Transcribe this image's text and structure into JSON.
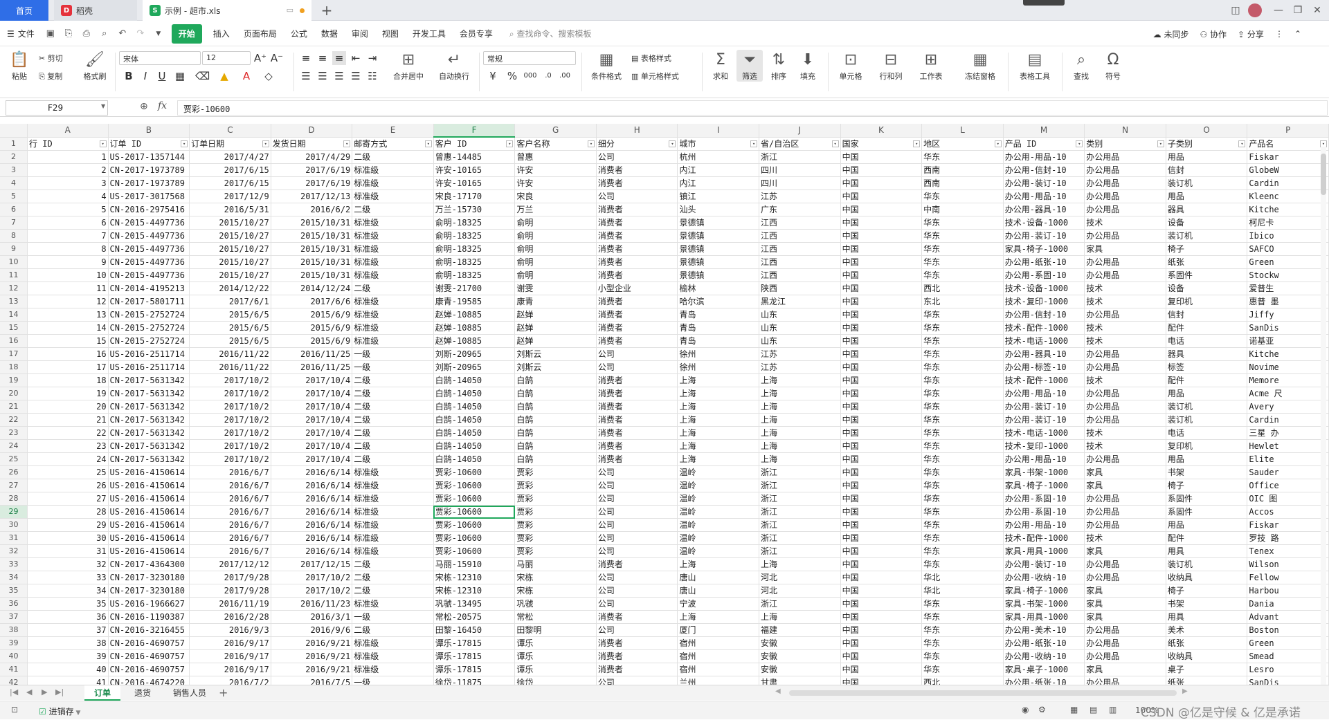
{
  "window": {
    "tabs": [
      {
        "label": "首页"
      },
      {
        "label": "稻壳"
      },
      {
        "label": "示例 - 超市.xls"
      }
    ]
  },
  "menu": {
    "file_label": "文件",
    "items": [
      "开始",
      "插入",
      "页面布局",
      "公式",
      "数据",
      "审阅",
      "视图",
      "开发工具",
      "会员专享"
    ],
    "search_placeholder": "查找命令、搜索模板",
    "sync_label": "未同步",
    "collab_label": "协作",
    "share_label": "分享"
  },
  "ribbon": {
    "paste": "粘贴",
    "cut": "剪切",
    "copy": "复制",
    "format_painter": "格式刷",
    "font_name": "宋体",
    "font_size": "12",
    "merge": "合并居中",
    "wrap": "自动换行",
    "number_format": "常规",
    "cond_format": "条件格式",
    "table_style": "表格样式",
    "cell_style": "单元格样式",
    "sum": "求和",
    "filter": "筛选",
    "sort": "排序",
    "fill": "填充",
    "cell": "单元格",
    "row_col": "行和列",
    "worksheet": "工作表",
    "freeze": "冻结窗格",
    "table_tools": "表格工具",
    "find": "查找",
    "symbol": "符号"
  },
  "formula_bar": {
    "name_box": "F29",
    "fx": "fx",
    "content": "贾彩-10600"
  },
  "grid": {
    "columns": [
      "A",
      "B",
      "C",
      "D",
      "E",
      "F",
      "G",
      "H",
      "I",
      "J",
      "K",
      "L",
      "M",
      "N",
      "O",
      "P"
    ],
    "selected_column": "F",
    "selected_row": 29,
    "headers": [
      "行 ID",
      "订单 ID",
      "订单日期",
      "发货日期",
      "邮寄方式",
      "客户 ID",
      "客户名称",
      "细分",
      "城市",
      "省/自治区",
      "国家",
      "地区",
      "产品 ID",
      "类别",
      "子类别",
      "产品名"
    ],
    "rows": [
      [
        "1",
        "US-2017-1357144",
        "2017/4/27",
        "2017/4/29",
        "二级",
        "曾惠-14485",
        "曾惠",
        "公司",
        "杭州",
        "浙江",
        "中国",
        "华东",
        "办公用-用品-10",
        "办公用品",
        "用品",
        "Fiskar"
      ],
      [
        "2",
        "CN-2017-1973789",
        "2017/6/15",
        "2017/6/19",
        "标准级",
        "许安-10165",
        "许安",
        "消费者",
        "内江",
        "四川",
        "中国",
        "西南",
        "办公用-信封-10",
        "办公用品",
        "信封",
        "GlobeW"
      ],
      [
        "3",
        "CN-2017-1973789",
        "2017/6/15",
        "2017/6/19",
        "标准级",
        "许安-10165",
        "许安",
        "消费者",
        "内江",
        "四川",
        "中国",
        "西南",
        "办公用-装订-10",
        "办公用品",
        "装订机",
        "Cardin"
      ],
      [
        "4",
        "US-2017-3017568",
        "2017/12/9",
        "2017/12/13",
        "标准级",
        "宋良-17170",
        "宋良",
        "公司",
        "镇江",
        "江苏",
        "中国",
        "华东",
        "办公用-用品-10",
        "办公用品",
        "用品",
        "Kleenc"
      ],
      [
        "5",
        "CN-2016-2975416",
        "2016/5/31",
        "2016/6/2",
        "二级",
        "万兰-15730",
        "万兰",
        "消费者",
        "汕头",
        "广东",
        "中国",
        "中南",
        "办公用-器具-10",
        "办公用品",
        "器具",
        "Kitche"
      ],
      [
        "6",
        "CN-2015-4497736",
        "2015/10/27",
        "2015/10/31",
        "标准级",
        "俞明-18325",
        "俞明",
        "消费者",
        "景德镇",
        "江西",
        "中国",
        "华东",
        "技术-设备-1000",
        "技术",
        "设备",
        "柯尼卡"
      ],
      [
        "7",
        "CN-2015-4497736",
        "2015/10/27",
        "2015/10/31",
        "标准级",
        "俞明-18325",
        "俞明",
        "消费者",
        "景德镇",
        "江西",
        "中国",
        "华东",
        "办公用-装订-10",
        "办公用品",
        "装订机",
        "Ibico "
      ],
      [
        "8",
        "CN-2015-4497736",
        "2015/10/27",
        "2015/10/31",
        "标准级",
        "俞明-18325",
        "俞明",
        "消费者",
        "景德镇",
        "江西",
        "中国",
        "华东",
        "家具-椅子-1000",
        "家具",
        "椅子",
        "SAFCO "
      ],
      [
        "9",
        "CN-2015-4497736",
        "2015/10/27",
        "2015/10/31",
        "标准级",
        "俞明-18325",
        "俞明",
        "消费者",
        "景德镇",
        "江西",
        "中国",
        "华东",
        "办公用-纸张-10",
        "办公用品",
        "纸张",
        "Green "
      ],
      [
        "10",
        "CN-2015-4497736",
        "2015/10/27",
        "2015/10/31",
        "标准级",
        "俞明-18325",
        "俞明",
        "消费者",
        "景德镇",
        "江西",
        "中国",
        "华东",
        "办公用-系固-10",
        "办公用品",
        "系固件",
        "Stockw"
      ],
      [
        "11",
        "CN-2014-4195213",
        "2014/12/22",
        "2014/12/24",
        "二级",
        "谢雯-21700",
        "谢雯",
        "小型企业",
        "榆林",
        "陕西",
        "中国",
        "西北",
        "技术-设备-1000",
        "技术",
        "设备",
        "爱普生"
      ],
      [
        "12",
        "CN-2017-5801711",
        "2017/6/1",
        "2017/6/6",
        "标准级",
        "康青-19585",
        "康青",
        "消费者",
        "哈尔滨",
        "黑龙江",
        "中国",
        "东北",
        "技术-复印-1000",
        "技术",
        "复印机",
        "惠普 墨"
      ],
      [
        "13",
        "CN-2015-2752724",
        "2015/6/5",
        "2015/6/9",
        "标准级",
        "赵婵-10885",
        "赵婵",
        "消费者",
        "青岛",
        "山东",
        "中国",
        "华东",
        "办公用-信封-10",
        "办公用品",
        "信封",
        "Jiffy "
      ],
      [
        "14",
        "CN-2015-2752724",
        "2015/6/5",
        "2015/6/9",
        "标准级",
        "赵婵-10885",
        "赵婵",
        "消费者",
        "青岛",
        "山东",
        "中国",
        "华东",
        "技术-配件-1000",
        "技术",
        "配件",
        "SanDis"
      ],
      [
        "15",
        "CN-2015-2752724",
        "2015/6/5",
        "2015/6/9",
        "标准级",
        "赵婵-10885",
        "赵婵",
        "消费者",
        "青岛",
        "山东",
        "中国",
        "华东",
        "技术-电话-1000",
        "技术",
        "电话",
        "诺基亚"
      ],
      [
        "16",
        "US-2016-2511714",
        "2016/11/22",
        "2016/11/25",
        "一级",
        "刘斯-20965",
        "刘斯云",
        "公司",
        "徐州",
        "江苏",
        "中国",
        "华东",
        "办公用-器具-10",
        "办公用品",
        "器具",
        "Kitche"
      ],
      [
        "17",
        "US-2016-2511714",
        "2016/11/22",
        "2016/11/25",
        "一级",
        "刘斯-20965",
        "刘斯云",
        "公司",
        "徐州",
        "江苏",
        "中国",
        "华东",
        "办公用-标签-10",
        "办公用品",
        "标签",
        "Novime"
      ],
      [
        "18",
        "CN-2017-5631342",
        "2017/10/2",
        "2017/10/4",
        "二级",
        "白鹄-14050",
        "白鹄",
        "消费者",
        "上海",
        "上海",
        "中国",
        "华东",
        "技术-配件-1000",
        "技术",
        "配件",
        "Memore"
      ],
      [
        "19",
        "CN-2017-5631342",
        "2017/10/2",
        "2017/10/4",
        "二级",
        "白鹄-14050",
        "白鹄",
        "消费者",
        "上海",
        "上海",
        "中国",
        "华东",
        "办公用-用品-10",
        "办公用品",
        "用品",
        "Acme 尺"
      ],
      [
        "20",
        "CN-2017-5631342",
        "2017/10/2",
        "2017/10/4",
        "二级",
        "白鹄-14050",
        "白鹄",
        "消费者",
        "上海",
        "上海",
        "中国",
        "华东",
        "办公用-装订-10",
        "办公用品",
        "装订机",
        "Avery "
      ],
      [
        "21",
        "CN-2017-5631342",
        "2017/10/2",
        "2017/10/4",
        "二级",
        "白鹄-14050",
        "白鹄",
        "消费者",
        "上海",
        "上海",
        "中国",
        "华东",
        "办公用-装订-10",
        "办公用品",
        "装订机",
        "Cardin"
      ],
      [
        "22",
        "CN-2017-5631342",
        "2017/10/2",
        "2017/10/4",
        "二级",
        "白鹄-14050",
        "白鹄",
        "消费者",
        "上海",
        "上海",
        "中国",
        "华东",
        "技术-电话-1000",
        "技术",
        "电话",
        "三星 办"
      ],
      [
        "23",
        "CN-2017-5631342",
        "2017/10/2",
        "2017/10/4",
        "二级",
        "白鹄-14050",
        "白鹄",
        "消费者",
        "上海",
        "上海",
        "中国",
        "华东",
        "技术-复印-1000",
        "技术",
        "复印机",
        "Hewlet"
      ],
      [
        "24",
        "CN-2017-5631342",
        "2017/10/2",
        "2017/10/4",
        "二级",
        "白鹄-14050",
        "白鹄",
        "消费者",
        "上海",
        "上海",
        "中国",
        "华东",
        "办公用-用品-10",
        "办公用品",
        "用品",
        "Elite "
      ],
      [
        "25",
        "US-2016-4150614",
        "2016/6/7",
        "2016/6/14",
        "标准级",
        "贾彩-10600",
        "贾彩",
        "公司",
        "温岭",
        "浙江",
        "中国",
        "华东",
        "家具-书架-1000",
        "家具",
        "书架",
        "Sauder"
      ],
      [
        "26",
        "US-2016-4150614",
        "2016/6/7",
        "2016/6/14",
        "标准级",
        "贾彩-10600",
        "贾彩",
        "公司",
        "温岭",
        "浙江",
        "中国",
        "华东",
        "家具-椅子-1000",
        "家具",
        "椅子",
        "Office"
      ],
      [
        "27",
        "US-2016-4150614",
        "2016/6/7",
        "2016/6/14",
        "标准级",
        "贾彩-10600",
        "贾彩",
        "公司",
        "温岭",
        "浙江",
        "中国",
        "华东",
        "办公用-系固-10",
        "办公用品",
        "系固件",
        "OIC 图"
      ],
      [
        "28",
        "US-2016-4150614",
        "2016/6/7",
        "2016/6/14",
        "标准级",
        "贾彩-10600",
        "贾彩",
        "公司",
        "温岭",
        "浙江",
        "中国",
        "华东",
        "办公用-系固-10",
        "办公用品",
        "系固件",
        "Accos "
      ],
      [
        "29",
        "US-2016-4150614",
        "2016/6/7",
        "2016/6/14",
        "标准级",
        "贾彩-10600",
        "贾彩",
        "公司",
        "温岭",
        "浙江",
        "中国",
        "华东",
        "办公用-用品-10",
        "办公用品",
        "用品",
        "Fiskar"
      ],
      [
        "30",
        "US-2016-4150614",
        "2016/6/7",
        "2016/6/14",
        "标准级",
        "贾彩-10600",
        "贾彩",
        "公司",
        "温岭",
        "浙江",
        "中国",
        "华东",
        "技术-配件-1000",
        "技术",
        "配件",
        "罗技 路"
      ],
      [
        "31",
        "US-2016-4150614",
        "2016/6/7",
        "2016/6/14",
        "标准级",
        "贾彩-10600",
        "贾彩",
        "公司",
        "温岭",
        "浙江",
        "中国",
        "华东",
        "家具-用具-1000",
        "家具",
        "用具",
        "Tenex "
      ],
      [
        "32",
        "CN-2017-4364300",
        "2017/12/12",
        "2017/12/15",
        "二级",
        "马丽-15910",
        "马丽",
        "消费者",
        "上海",
        "上海",
        "中国",
        "华东",
        "办公用-装订-10",
        "办公用品",
        "装订机",
        "Wilson"
      ],
      [
        "33",
        "CN-2017-3230180",
        "2017/9/28",
        "2017/10/2",
        "二级",
        "宋栋-12310",
        "宋栋",
        "公司",
        "唐山",
        "河北",
        "中国",
        "华北",
        "办公用-收纳-10",
        "办公用品",
        "收纳具",
        "Fellow"
      ],
      [
        "34",
        "CN-2017-3230180",
        "2017/9/28",
        "2017/10/2",
        "二级",
        "宋栋-12310",
        "宋栋",
        "公司",
        "唐山",
        "河北",
        "中国",
        "华北",
        "家具-椅子-1000",
        "家具",
        "椅子",
        "Harbou"
      ],
      [
        "35",
        "US-2016-1966627",
        "2016/11/19",
        "2016/11/23",
        "标准级",
        "巩虢-13495",
        "巩虢",
        "公司",
        "宁波",
        "浙江",
        "中国",
        "华东",
        "家具-书架-1000",
        "家具",
        "书架",
        "Dania "
      ],
      [
        "36",
        "CN-2016-1190387",
        "2016/2/28",
        "2016/3/1",
        "一级",
        "常松-20575",
        "常松",
        "消费者",
        "上海",
        "上海",
        "中国",
        "华东",
        "家具-用具-1000",
        "家具",
        "用具",
        "Advant"
      ],
      [
        "37",
        "CN-2016-3216455",
        "2016/9/3",
        "2016/9/6",
        "二级",
        "田黎-16450",
        "田黎明",
        "公司",
        "厦门",
        "福建",
        "中国",
        "华东",
        "办公用-美术-10",
        "办公用品",
        "美术",
        "Boston"
      ],
      [
        "38",
        "CN-2016-4690757",
        "2016/9/17",
        "2016/9/21",
        "标准级",
        "谭乐-17815",
        "谭乐",
        "消费者",
        "宿州",
        "安徽",
        "中国",
        "华东",
        "办公用-纸张-10",
        "办公用品",
        "纸张",
        "Green "
      ],
      [
        "39",
        "CN-2016-4690757",
        "2016/9/17",
        "2016/9/21",
        "标准级",
        "谭乐-17815",
        "谭乐",
        "消费者",
        "宿州",
        "安徽",
        "中国",
        "华东",
        "办公用-收纳-10",
        "办公用品",
        "收纳具",
        "Smead "
      ],
      [
        "40",
        "CN-2016-4690757",
        "2016/9/17",
        "2016/9/21",
        "标准级",
        "谭乐-17815",
        "谭乐",
        "消费者",
        "宿州",
        "安徽",
        "中国",
        "华东",
        "家具-桌子-1000",
        "家具",
        "桌子",
        "Lesro "
      ],
      [
        "41",
        "CN-2016-4674220",
        "2016/7/2",
        "2016/7/5",
        "一级",
        "徐岱-11875",
        "徐岱",
        "公司",
        "兰州",
        "甘肃",
        "中国",
        "西北",
        "办公用-纸张-10",
        "办公用品",
        "纸张",
        "SanDis"
      ]
    ]
  },
  "sheets": [
    "订单",
    "退货",
    "销售人员"
  ],
  "active_sheet": "订单",
  "status": {
    "left_label": "进销存",
    "watermark": "CSDN @亿是守候 & 亿是承诺",
    "zoom": "100%"
  },
  "colors": {
    "accent": "#1fa85b",
    "home_tab": "#2f6ee7"
  }
}
